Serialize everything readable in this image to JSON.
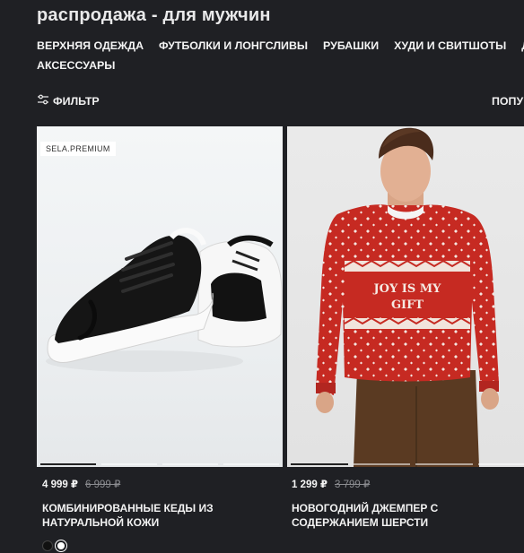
{
  "page_title": "распродажа - для мужчин",
  "categories": [
    "ВЕРХНЯЯ ОДЕЖДА",
    "ФУТБОЛКИ И ЛОНГСЛИВЫ",
    "РУБАШКИ",
    "ХУДИ И СВИТШОТЫ",
    "Д",
    "АКСЕССУАРЫ"
  ],
  "toolbar": {
    "filter_label": "ФИЛЬТР",
    "sort_label": "ПОПУ"
  },
  "products": [
    {
      "brand": "SELA.PREMIUM",
      "price_now": "4 999 ₽",
      "price_old": "6 999 ₽",
      "name": "КОМБИНИРОВАННЫЕ КЕДЫ ИЗ НАТУРАЛЬНОЙ КОЖИ",
      "swatches": [
        "#111111",
        "#ffffff"
      ]
    },
    {
      "price_now": "1 299 ₽",
      "price_old": "3 799 ₽",
      "name": "НОВОГОДНИЙ ДЖЕМПЕР С СОДЕРЖАНИЕМ ШЕРСТИ",
      "print_line1": "JOY IS MY",
      "print_line2": "GIFT"
    }
  ],
  "colors": {
    "background": "#1f2024",
    "sweater_red": "#c62a22",
    "pants_brown": "#5a3a22"
  }
}
